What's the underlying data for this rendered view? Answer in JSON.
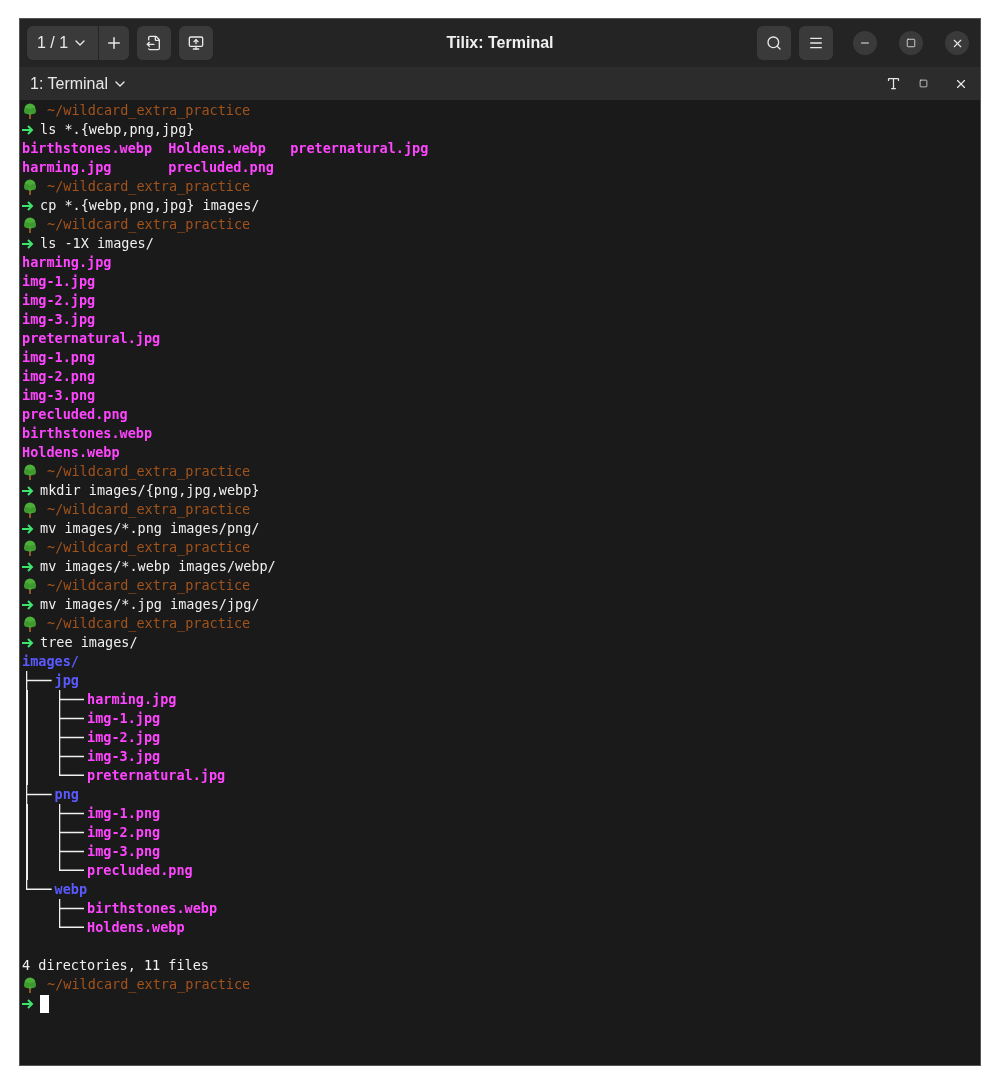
{
  "window": {
    "title": "Tilix: Terminal",
    "session_switcher": "1 / 1"
  },
  "tab": {
    "label": "1: Terminal"
  },
  "terminal": {
    "lines": [
      {
        "kind": "prompt",
        "path": "~/wildcard_extra_practice"
      },
      {
        "kind": "command",
        "text": "ls *.{webp,png,jpg}"
      },
      {
        "kind": "file_columns",
        "rows": [
          [
            "birthstones.webp",
            "Holdens.webp",
            "preternatural.jpg"
          ],
          [
            "harming.jpg",
            "precluded.png"
          ]
        ]
      },
      {
        "kind": "prompt",
        "path": "~/wildcard_extra_practice"
      },
      {
        "kind": "command",
        "text": "cp *.{webp,png,jpg} images/"
      },
      {
        "kind": "prompt",
        "path": "~/wildcard_extra_practice"
      },
      {
        "kind": "command",
        "text": "ls -1X images/"
      },
      {
        "kind": "file",
        "text": "harming.jpg"
      },
      {
        "kind": "file",
        "text": "img-1.jpg"
      },
      {
        "kind": "file",
        "text": "img-2.jpg"
      },
      {
        "kind": "file",
        "text": "img-3.jpg"
      },
      {
        "kind": "file",
        "text": "preternatural.jpg"
      },
      {
        "kind": "file",
        "text": "img-1.png"
      },
      {
        "kind": "file",
        "text": "img-2.png"
      },
      {
        "kind": "file",
        "text": "img-3.png"
      },
      {
        "kind": "file",
        "text": "precluded.png"
      },
      {
        "kind": "file",
        "text": "birthstones.webp"
      },
      {
        "kind": "file",
        "text": "Holdens.webp"
      },
      {
        "kind": "prompt",
        "path": "~/wildcard_extra_practice"
      },
      {
        "kind": "command",
        "text": "mkdir images/{png,jpg,webp}"
      },
      {
        "kind": "prompt",
        "path": "~/wildcard_extra_practice"
      },
      {
        "kind": "command",
        "text": "mv images/*.png images/png/"
      },
      {
        "kind": "prompt",
        "path": "~/wildcard_extra_practice"
      },
      {
        "kind": "command",
        "text": "mv images/*.webp images/webp/"
      },
      {
        "kind": "prompt",
        "path": "~/wildcard_extra_practice"
      },
      {
        "kind": "command",
        "text": "mv images/*.jpg images/jpg/"
      },
      {
        "kind": "prompt",
        "path": "~/wildcard_extra_practice"
      },
      {
        "kind": "command",
        "text": "tree images/"
      },
      {
        "kind": "tree",
        "root": {
          "name": "images/",
          "kind": "dir",
          "children": [
            {
              "name": "jpg",
              "kind": "dir",
              "children": [
                {
                  "name": "harming.jpg",
                  "kind": "file"
                },
                {
                  "name": "img-1.jpg",
                  "kind": "file"
                },
                {
                  "name": "img-2.jpg",
                  "kind": "file"
                },
                {
                  "name": "img-3.jpg",
                  "kind": "file"
                },
                {
                  "name": "preternatural.jpg",
                  "kind": "file"
                }
              ]
            },
            {
              "name": "png",
              "kind": "dir",
              "children": [
                {
                  "name": "img-1.png",
                  "kind": "file"
                },
                {
                  "name": "img-2.png",
                  "kind": "file"
                },
                {
                  "name": "img-3.png",
                  "kind": "file"
                },
                {
                  "name": "precluded.png",
                  "kind": "file"
                }
              ]
            },
            {
              "name": "webp",
              "kind": "dir",
              "children": [
                {
                  "name": "birthstones.webp",
                  "kind": "file"
                },
                {
                  "name": "Holdens.webp",
                  "kind": "file"
                }
              ]
            }
          ]
        }
      },
      {
        "kind": "blank"
      },
      {
        "kind": "text",
        "text": "4 directories, 11 files"
      },
      {
        "kind": "prompt",
        "path": "~/wildcard_extra_practice"
      },
      {
        "kind": "input",
        "cursor": true
      }
    ]
  }
}
